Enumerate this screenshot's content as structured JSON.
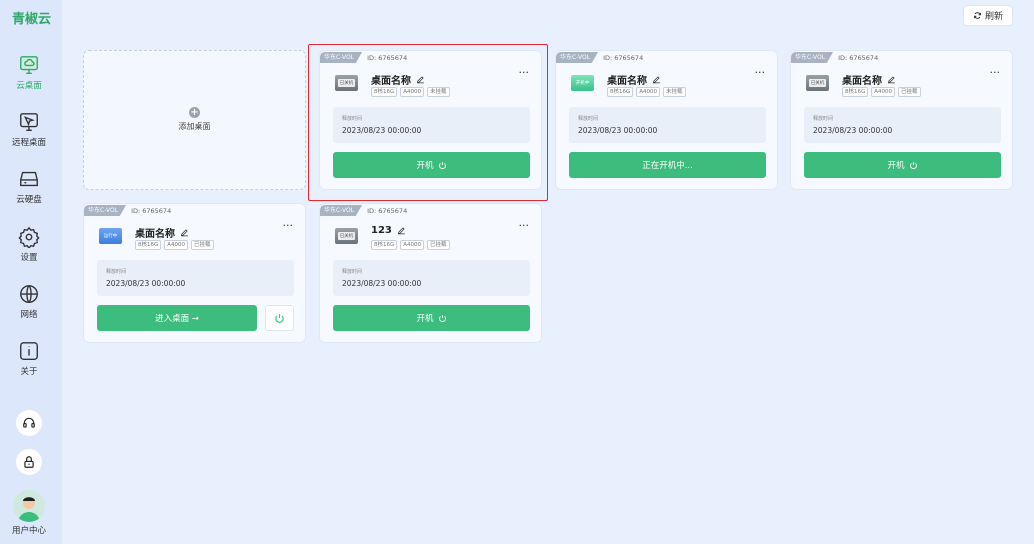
{
  "app": {
    "logo": "青椒云"
  },
  "sidebar": {
    "items": [
      {
        "label": "云桌面",
        "icon": "cloud-desktop-icon",
        "active": true
      },
      {
        "label": "远程桌面",
        "icon": "remote-desktop-icon",
        "active": false
      },
      {
        "label": "云硬盘",
        "icon": "cloud-disk-icon",
        "active": false
      },
      {
        "label": "设置",
        "icon": "settings-gear-icon",
        "active": false
      },
      {
        "label": "网络",
        "icon": "globe-icon",
        "active": false
      },
      {
        "label": "关于",
        "icon": "info-icon",
        "active": false
      }
    ],
    "utilities": [
      {
        "icon": "headset-icon"
      },
      {
        "icon": "lock-icon"
      }
    ],
    "user": {
      "label": "用户中心",
      "icon": "avatar"
    }
  },
  "toolbar": {
    "refresh_label": "刷新"
  },
  "add_card": {
    "label": "添加桌面"
  },
  "colors": {
    "accent": "#3dbd7d",
    "selection": "#e6292f",
    "background": "#e8effd"
  },
  "cards": [
    {
      "region": "华东C-VOL",
      "id": "ID: 6765674",
      "name": "桌面名称",
      "status": "已关机",
      "thumb": "off",
      "specs": [
        "8核16G",
        "A4000",
        "未挂载"
      ],
      "time_label": "释放时间",
      "time_value": "2023/08/23 00:00:00",
      "action": "开机",
      "selected": true
    },
    {
      "region": "华东C-VOL",
      "id": "ID: 6765674",
      "name": "桌面名称",
      "status": "开机中",
      "thumb": "starting",
      "specs": [
        "8核16G",
        "A4000",
        "未挂载"
      ],
      "time_label": "释放时间",
      "time_value": "2023/08/23 00:00:00",
      "action": "正在开机中..."
    },
    {
      "region": "华东C-VOL",
      "id": "ID: 6765674",
      "name": "桌面名称",
      "status": "已关机",
      "thumb": "off",
      "specs": [
        "8核16G",
        "A4000",
        "已挂载"
      ],
      "time_label": "释放时间",
      "time_value": "2023/08/23 00:00:00",
      "action": "开机"
    },
    {
      "region": "华东C-VOL",
      "id": "ID: 6765674",
      "name": "桌面名称",
      "status": "运行中",
      "thumb": "running",
      "specs": [
        "8核16G",
        "A4000",
        "已挂载"
      ],
      "time_label": "释放时间",
      "time_value": "2023/08/23 00:00:00",
      "action": "进入桌面 →"
    },
    {
      "region": "华东C-VOL",
      "id": "ID: 6765674",
      "name": "123",
      "status": "已关机",
      "thumb": "off",
      "specs": [
        "8核16G",
        "A4000",
        "已挂载"
      ],
      "time_label": "释放时间",
      "time_value": "2023/08/23 00:00:00",
      "action": "开机"
    }
  ]
}
